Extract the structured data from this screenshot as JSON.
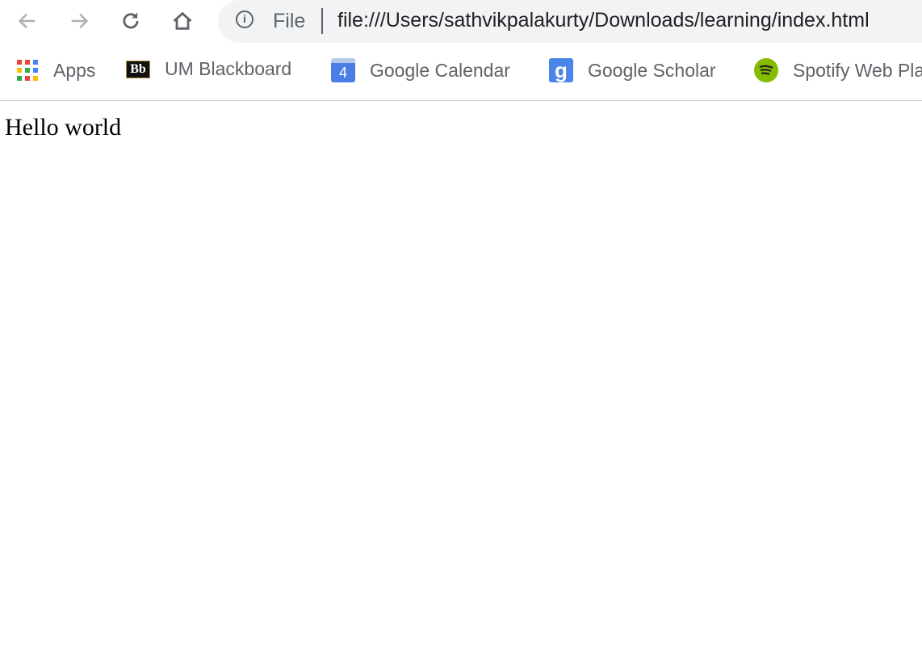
{
  "toolbar": {
    "site_label": "File",
    "url": "file:///Users/sathvikpalakurty/Downloads/learning/index.html"
  },
  "bookmarks": [
    {
      "label": "Apps",
      "icon": "apps-grid-icon"
    },
    {
      "label": "UM Blackboard",
      "icon": "blackboard-icon",
      "icon_text": "Bb"
    },
    {
      "label": "Google Calendar",
      "icon": "calendar-icon",
      "icon_text": "4"
    },
    {
      "label": "Google Scholar",
      "icon": "scholar-icon",
      "icon_text": "g"
    },
    {
      "label": "Spotify Web Player",
      "icon": "spotify-icon"
    }
  ],
  "page": {
    "text": "Hello world"
  }
}
